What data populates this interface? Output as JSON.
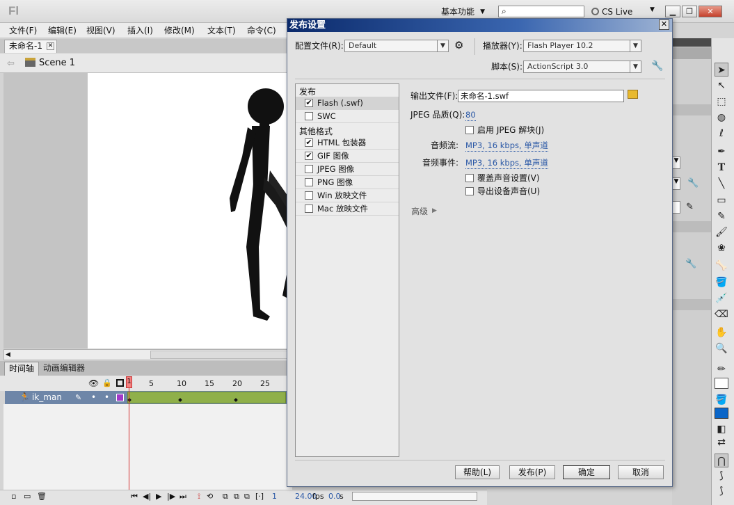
{
  "app": {
    "logo": "Fl",
    "workspace": "基本功能",
    "cs_live": "CS Live"
  },
  "menu": [
    "文件(F)",
    "编辑(E)",
    "视图(V)",
    "插入(I)",
    "修改(M)",
    "文本(T)",
    "命令(C)"
  ],
  "document": {
    "tab_title": "未命名-1",
    "scene": "Scene 1"
  },
  "timeline": {
    "tabs": [
      "时间轴",
      "动画编辑器"
    ],
    "ruler": [
      "1",
      "5",
      "10",
      "15",
      "20",
      "25"
    ],
    "layer_name": "ik_man",
    "current_frame": "1",
    "fps": "24.00",
    "fps_unit": "fps",
    "time": "0.0",
    "time_unit": "s"
  },
  "dialog": {
    "title": "发布设置",
    "profile_label": "配置文件(R):",
    "profile_value": "Default",
    "player_label": "播放器(Y):",
    "player_value": "Flash Player 10.2",
    "script_label": "脚本(S):",
    "script_value": "ActionScript 3.0",
    "publish_header": "发布",
    "other_header": "其他格式",
    "formats": [
      {
        "label": "Flash (.swf)",
        "checked": true
      },
      {
        "label": "SWC",
        "checked": false
      }
    ],
    "other_formats": [
      {
        "label": "HTML 包装器",
        "checked": true
      },
      {
        "label": "GIF 图像",
        "checked": true
      },
      {
        "label": "JPEG 图像",
        "checked": false
      },
      {
        "label": "PNG 图像",
        "checked": false
      },
      {
        "label": "Win 放映文件",
        "checked": false
      },
      {
        "label": "Mac 放映文件",
        "checked": false
      }
    ],
    "output_label": "输出文件(F):",
    "output_value": "未命名-1.swf",
    "jpeg_quality_label": "JPEG 品质(Q):",
    "jpeg_quality_value": "80",
    "enable_jpeg_deblock": "启用 JPEG 解块(J)",
    "audio_stream_label": "音频流:",
    "audio_stream_value": "MP3, 16 kbps, 单声道",
    "audio_event_label": "音频事件:",
    "audio_event_value": "MP3, 16 kbps, 单声道",
    "override_sound": "覆盖声音设置(V)",
    "export_device_sound": "导出设备声音(U)",
    "advanced": "高级",
    "buttons": {
      "help": "帮助(L)",
      "publish": "发布(P)",
      "ok": "确定",
      "cancel": "取消"
    }
  }
}
